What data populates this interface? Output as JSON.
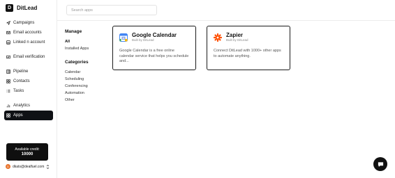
{
  "brand": {
    "name": "DitLead",
    "logo_letter": "D"
  },
  "sidebar": {
    "groups": [
      [
        {
          "label": "Campaigns",
          "icon": "send-icon"
        },
        {
          "label": "Email accounts",
          "icon": "mail-icon"
        },
        {
          "label": "Linked n account",
          "icon": "linkedin-icon"
        }
      ],
      [
        {
          "label": "Email verification",
          "icon": "verify-icon"
        }
      ],
      [
        {
          "label": "Pipeline",
          "icon": "pipeline-icon"
        },
        {
          "label": "Contacts",
          "icon": "contacts-icon"
        },
        {
          "label": "Tasks",
          "icon": "tasks-icon"
        }
      ],
      [
        {
          "label": "Analytics",
          "icon": "analytics-icon"
        },
        {
          "label": "Apps",
          "icon": "apps-icon",
          "active": true
        }
      ]
    ],
    "credit": {
      "label": "Available credit:",
      "value": "10000"
    },
    "user": {
      "email": "dkats@dealfuel.com",
      "initial": "D"
    }
  },
  "search": {
    "placeholder": "Search apps",
    "value": ""
  },
  "filters": {
    "manage_heading": "Manage",
    "manage_items": [
      "All",
      "Installed Apps"
    ],
    "categories_heading": "Categories",
    "category_items": [
      "Calendar",
      "Scheduling",
      "Conferencing",
      "Automation",
      "Other"
    ]
  },
  "apps": [
    {
      "title": "Google Calendar",
      "built_by": "Built by DitLead",
      "description": "Google Calendar is a free online calendar service that helps you schedule and...",
      "icon": "google-calendar-icon"
    },
    {
      "title": "Zapier",
      "built_by": "Built by DitLead",
      "description": "Connect DitLead with 1000+ other apps to automate anything.",
      "icon": "zapier-icon"
    }
  ],
  "colors": {
    "active_bg": "#0f1115",
    "accent_orange": "#e8732c",
    "zapier": "#ff4f00"
  }
}
